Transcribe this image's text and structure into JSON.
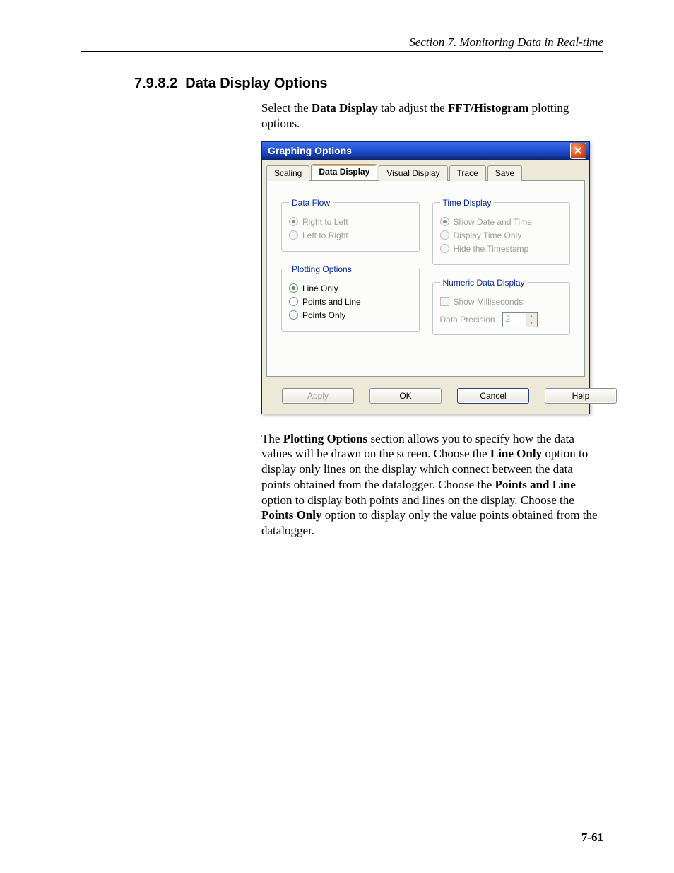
{
  "header": {
    "running": "Section 7.  Monitoring Data in Real-time",
    "section_no": "7.9.8.2",
    "section_title": "Data Display Options"
  },
  "intro_parts": {
    "a": "Select the ",
    "b": "Data Display",
    "c": " tab adjust the ",
    "d": "FFT/Histogram",
    "e": " plotting options."
  },
  "dialog": {
    "title": "Graphing Options",
    "tabs": {
      "scaling": "Scaling",
      "data_display": "Data Display",
      "visual_display": "Visual Display",
      "trace": "Trace",
      "save": "Save"
    },
    "data_flow": {
      "legend": "Data Flow",
      "right_to_left": "Right to Left",
      "left_to_right": "Left to Right"
    },
    "plotting": {
      "legend": "Plotting Options",
      "line_only": "Line Only",
      "points_and_line": "Points and Line",
      "points_only": "Points Only"
    },
    "time_display": {
      "legend": "Time Display",
      "show_date_time": "Show Date and Time",
      "display_time_only": "Display Time Only",
      "hide_timestamp": "Hide the Timestamp"
    },
    "numeric": {
      "legend": "Numeric Data Display",
      "show_ms": "Show Milliseconds",
      "precision_label": "Data Precision",
      "precision_value": "2"
    },
    "buttons": {
      "apply": "Apply",
      "ok": "OK",
      "cancel": "Cancel",
      "help": "Help"
    }
  },
  "paragraph": {
    "a": "The ",
    "b": "Plotting Options",
    "c": " section allows you to specify how the data values will be drawn on the screen.  Choose the ",
    "d": "Line Only",
    "e": " option to display only lines on the display which connect between the data points obtained from the datalogger.  Choose the ",
    "f": "Points and Line",
    "g": " option to display both points and lines on the display.  Choose the ",
    "h": "Points Only",
    "i": " option to display only the value points obtained from the datalogger."
  },
  "page_number": "7-61"
}
